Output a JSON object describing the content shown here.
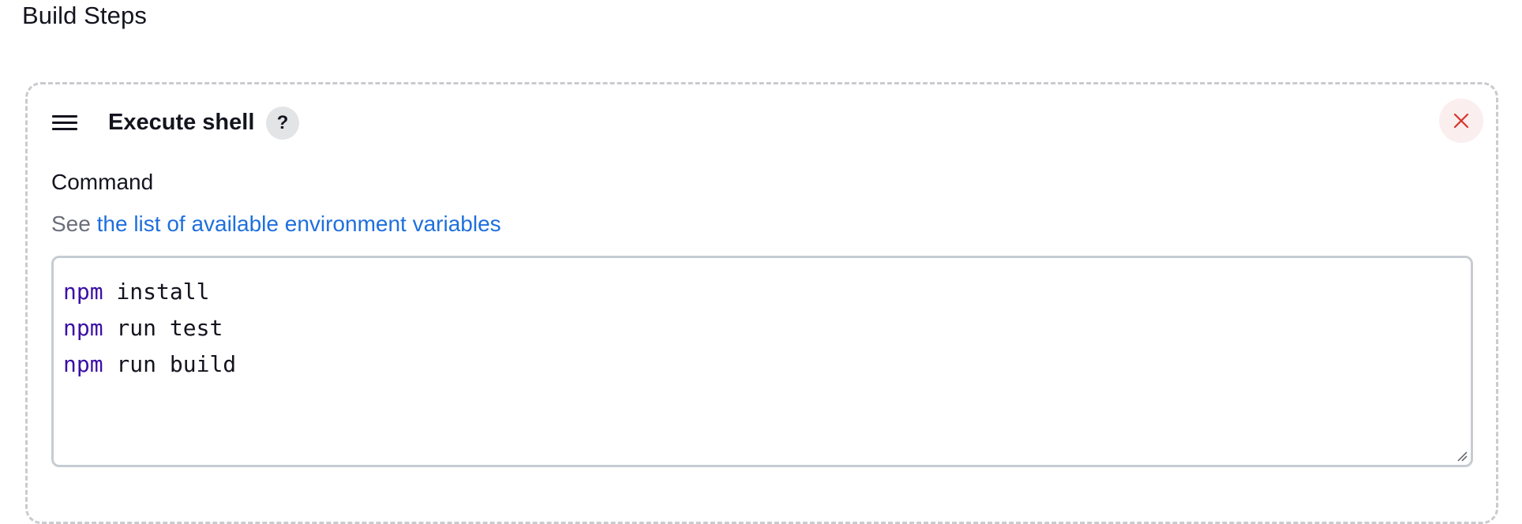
{
  "section": {
    "title": "Build Steps"
  },
  "step": {
    "title": "Execute shell",
    "help_label": "?",
    "drag_icon": "hamburger-drag-handle-icon",
    "delete_icon": "close-x-icon",
    "delete_color": "#d9332b",
    "delete_bg": "#fbeeee"
  },
  "command": {
    "label": "Command",
    "help_prefix": "See",
    "help_link_text": "the list of available environment variables",
    "link_color": "#1e6fdc",
    "lines": [
      {
        "keyword": "npm",
        "rest": " install"
      },
      {
        "keyword": "npm",
        "rest": " run test"
      },
      {
        "keyword": "npm",
        "rest": " run build"
      }
    ],
    "keyword_color": "#3c0fa6"
  }
}
